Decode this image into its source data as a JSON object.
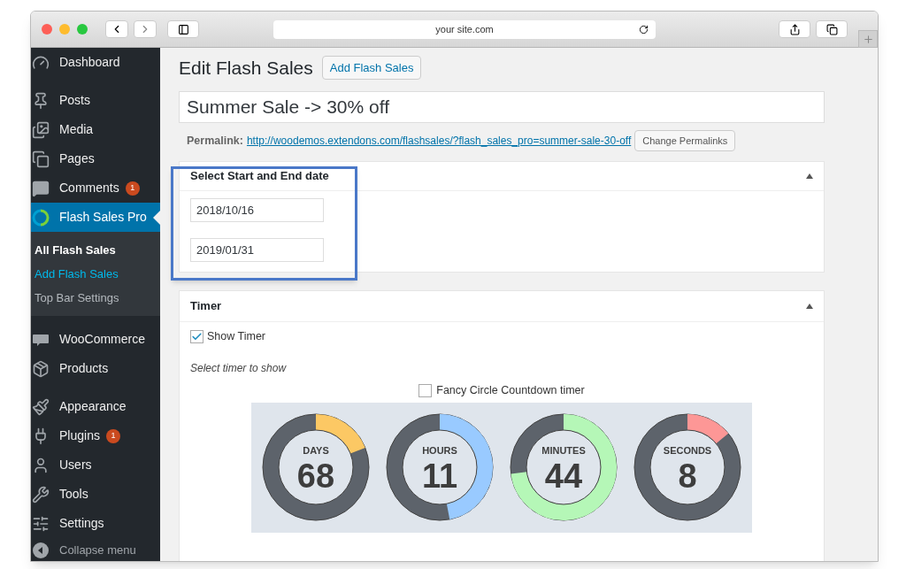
{
  "browser": {
    "address": "your site.com"
  },
  "sidebar": {
    "groups": [
      [
        {
          "label": "Dashboard",
          "selected": false
        }
      ],
      [
        {
          "label": "Posts",
          "selected": false
        },
        {
          "label": "Media",
          "selected": false
        },
        {
          "label": "Pages",
          "selected": false
        },
        {
          "label": "Comments",
          "selected": false,
          "badge": "1"
        },
        {
          "label": "Flash Sales Pro",
          "selected": true,
          "children": [
            {
              "label": "All Flash Sales",
              "selected": true,
              "hovered": false
            },
            {
              "label": "Add Flash Sales",
              "selected": false,
              "hovered": true
            },
            {
              "label": "Top Bar Settings",
              "selected": false,
              "hovered": false
            }
          ]
        }
      ],
      [
        {
          "label": "WooCommerce",
          "selected": false
        },
        {
          "label": "Products",
          "selected": false
        }
      ],
      [
        {
          "label": "Appearance",
          "selected": false
        },
        {
          "label": "Plugins",
          "selected": false,
          "badge": "1"
        },
        {
          "label": "Users",
          "selected": false
        },
        {
          "label": "Tools",
          "selected": false
        },
        {
          "label": "Settings",
          "selected": false
        }
      ]
    ],
    "collapse": "Collapse menu"
  },
  "page": {
    "title": "Edit Flash Sales",
    "add_button": "Add Flash Sales",
    "post_title": "Summer Sale -> 30% off",
    "permalink_label": "Permalink:",
    "permalink_url": "http://woodemos.extendons.com/flashsales/?flash_sales_pro=summer-sale-30-off",
    "change_button": "Change Permalinks"
  },
  "date_panel": {
    "title": "Select Start and End date",
    "start": "2018/10/16",
    "end": "2019/01/31",
    "highlighted": true
  },
  "timer_panel": {
    "title": "Timer",
    "show_timer": {
      "label": "Show Timer",
      "checked": true
    },
    "select_label": "Select timer to show",
    "fancy": {
      "label": "Fancy Circle Countdown timer",
      "checked": false
    },
    "rings": [
      {
        "label": "DAYS",
        "value": "68"
      },
      {
        "label": "HOURS",
        "value": "11"
      },
      {
        "label": "MINUTES",
        "value": "44"
      },
      {
        "label": "SECONDS",
        "value": "8"
      }
    ]
  }
}
